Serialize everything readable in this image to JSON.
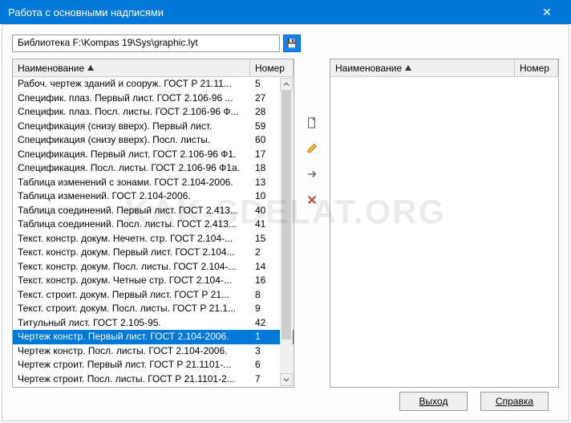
{
  "window": {
    "title": "Работа с основными надписями"
  },
  "library": {
    "path": "Библиотека F:\\Kompas 19\\Sys\\graphic.lyt"
  },
  "columns": {
    "name": "Наименование",
    "number": "Номер"
  },
  "rows": [
    {
      "name": "Рабоч. чертеж зданий и сооруж. ГОСТ Р 21.11...",
      "num": "5",
      "sel": false
    },
    {
      "name": "Специфик. плаз. Первый лист. ГОСТ 2.106-96 ...",
      "num": "27",
      "sel": false
    },
    {
      "name": "Специфик. плаз. Посл. листы. ГОСТ 2.106-96 Ф...",
      "num": "28",
      "sel": false
    },
    {
      "name": "Спецификация (снизу вверх). Первый лист.",
      "num": "59",
      "sel": false
    },
    {
      "name": "Спецификация (снизу вверх). Посл. листы.",
      "num": "60",
      "sel": false
    },
    {
      "name": "Спецификация. Первый лист. ГОСТ 2.106-96 Ф1.",
      "num": "17",
      "sel": false
    },
    {
      "name": "Спецификация. Посл. листы. ГОСТ 2.106-96 Ф1а.",
      "num": "18",
      "sel": false
    },
    {
      "name": "Таблица изменений с зонами. ГОСТ 2.104-2006.",
      "num": "13",
      "sel": false
    },
    {
      "name": "Таблица изменений. ГОСТ 2.104-2006.",
      "num": "10",
      "sel": false
    },
    {
      "name": "Таблица соединений. Первый лист. ГОСТ 2.413...",
      "num": "40",
      "sel": false
    },
    {
      "name": "Таблица соединений. Посл. листы. ГОСТ 2.413...",
      "num": "41",
      "sel": false
    },
    {
      "name": "Текст. констр. докум. Нечетн. стр. ГОСТ 2.104-...",
      "num": "15",
      "sel": false
    },
    {
      "name": "Текст. констр. докум. Первый лист. ГОСТ 2.104...",
      "num": "2",
      "sel": false
    },
    {
      "name": "Текст. констр. докум. Посл. листы. ГОСТ 2.104-...",
      "num": "14",
      "sel": false
    },
    {
      "name": "Текст. констр. докум. Четные стр. ГОСТ 2.104-...",
      "num": "16",
      "sel": false
    },
    {
      "name": "Текст. строит. докум. Первый лист. ГОСТ Р 21...",
      "num": "8",
      "sel": false
    },
    {
      "name": "Текст. строит. докум. Посл. листы. ГОСТ Р 21.1...",
      "num": "9",
      "sel": false
    },
    {
      "name": "Титульный лист. ГОСТ 2.105-95.",
      "num": "42",
      "sel": false
    },
    {
      "name": "Чертеж констр. Первый лист. ГОСТ 2.104-2006.",
      "num": "1",
      "sel": true
    },
    {
      "name": "Чертеж констр. Посл. листы. ГОСТ 2.104-2006.",
      "num": "3",
      "sel": false
    },
    {
      "name": "Чертеж строит. Первый лист. ГОСТ Р 21.1101-...",
      "num": "6",
      "sel": false
    },
    {
      "name": "Чертеж строит. Посл. листы. ГОСТ Р 21.1101-2...",
      "num": "7",
      "sel": false
    }
  ],
  "buttons": {
    "exit": "Выход",
    "exit_u": "В",
    "help": "Справка",
    "help_u": "С"
  },
  "watermark": "KAK-SDELAT.ORG"
}
